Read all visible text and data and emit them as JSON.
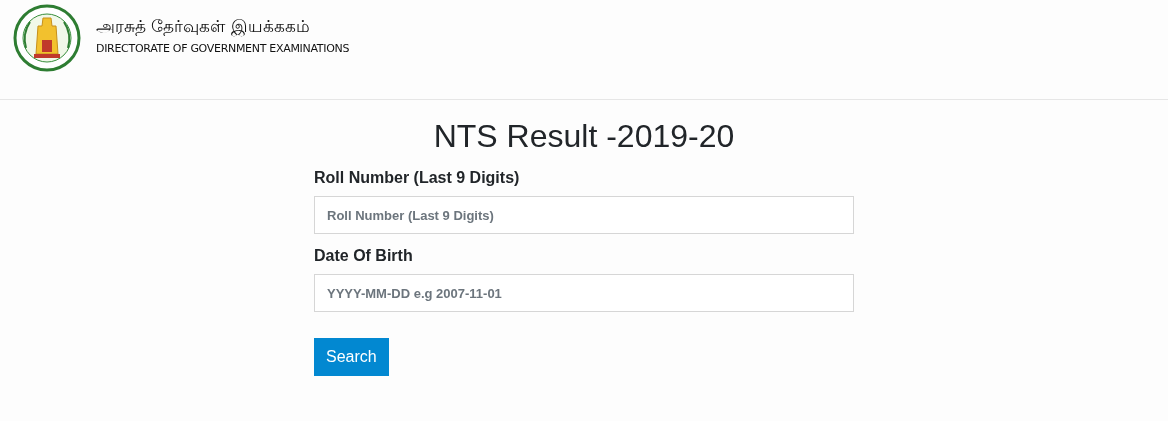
{
  "header": {
    "title_tamil": "அரசுத் தேர்வுகள் இயக்ககம்",
    "title_english": "DIRECTORATE OF GOVERNMENT EXAMINATIONS"
  },
  "page_title": "NTS Result -2019-20",
  "fields": [
    {
      "label": "Roll Number (Last 9 Digits)",
      "placeholder": "Roll Number (Last 9 Digits)"
    },
    {
      "label": "Date Of Birth",
      "placeholder": "YYYY-MM-DD e.g 2007-11-01"
    }
  ],
  "buttons": [
    {
      "label": "Search"
    }
  ]
}
